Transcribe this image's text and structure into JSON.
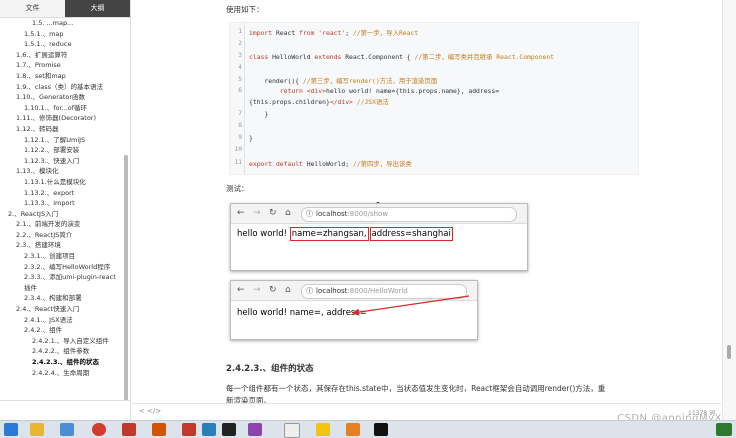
{
  "sidebar": {
    "tabs": [
      {
        "label": "文件"
      },
      {
        "label": "大纲"
      }
    ],
    "toc": [
      {
        "label": "1.5. ...map..."
      },
      {
        "label": "1.5.1.、map"
      },
      {
        "label": "1.5.1.、reduce"
      },
      {
        "label": "1.6.、扩展运算符"
      },
      {
        "label": "1.7.、Promise"
      },
      {
        "label": "1.8.、set和map"
      },
      {
        "label": "1.9.、class（类）的基本语法"
      },
      {
        "label": "1.10.、Generator函数"
      },
      {
        "label": "1.10.1.、for...of循环"
      },
      {
        "label": "1.11.、修饰器(Decorator)"
      },
      {
        "label": "1.12.、转码器"
      },
      {
        "label": "1.12.1.、了解UmiJS"
      },
      {
        "label": "1.12.2.、部署安装"
      },
      {
        "label": "1.12.3.、快速入门"
      },
      {
        "label": "1.13.、模块化"
      },
      {
        "label": "1.13.1.什么是模块化"
      },
      {
        "label": "1.13.2.、export"
      },
      {
        "label": "1.13.3.、import"
      },
      {
        "label": "2.、ReactJS入门"
      },
      {
        "label": "2.1.、前端开发的演变"
      },
      {
        "label": "2.2.、ReactJS简介"
      },
      {
        "label": "2.3.、搭建环境"
      },
      {
        "label": "2.3.1.、创建项目"
      },
      {
        "label": "2.3.2.、编写HelloWorld程序"
      },
      {
        "label": "2.3.3.、添加umi-plugin-react"
      },
      {
        "label": "插件"
      },
      {
        "label": "2.3.4.、构建和部署"
      },
      {
        "label": "2.4.、React快速入门"
      },
      {
        "label": "2.4.1.、JSX语法"
      },
      {
        "label": "2.4.2.、组件"
      },
      {
        "label": "2.4.2.1.、导入自定义组件"
      },
      {
        "label": "2.4.2.2.、组件参数"
      },
      {
        "label": "2.4.2.3.、组件的状态"
      },
      {
        "label": "2.4.2.4.、生命周期"
      }
    ]
  },
  "main": {
    "usage_text": "使用如下：",
    "code_lines": [
      {
        "n": "1",
        "t": "import React from 'react'; //第一步，导入React"
      },
      {
        "n": "2",
        "t": ""
      },
      {
        "n": "3",
        "t": "class HelloWorld extends React.Component { //第二步，编写类并且继承 React.Component"
      },
      {
        "n": "4",
        "t": ""
      },
      {
        "n": "5",
        "t": "    render(){ //第三步，编写render()方法，用于渲染页面"
      },
      {
        "n": "6",
        "t": "        return <div>hello world! name={this.props.name}, address="
      },
      {
        "n": "",
        "t": "{this.props.children}</div> //JSX语法"
      },
      {
        "n": "7",
        "t": "    }"
      },
      {
        "n": "8",
        "t": ""
      },
      {
        "n": "9",
        "t": "}"
      },
      {
        "n": "10",
        "t": ""
      },
      {
        "n": "11",
        "t": "export default HelloWorld; //第四步，导出该类"
      }
    ],
    "test_label": "测试：",
    "browser1": {
      "url_host": "localhost",
      "url_path": ":8000/show",
      "text_prefix": "hello world! ",
      "name_part": "name=zhangsan,",
      "addr_part": "address=shanghai"
    },
    "browser2": {
      "url_host": "localhost",
      "url_path": ":8000/HelloWorld",
      "text": "hello world! name=, address="
    },
    "section_heading": "2.4.2.3.、组件的状态",
    "para_line1": "每一个组件都有一个状态，其保存在this.state中，当状态值发生变化时，React框架会自动调用render()方法，重",
    "para_line2": "新渲染页面。"
  },
  "status": {
    "left": "<   </>",
    "word_count": "11378 词"
  },
  "watermark": "CSDN @anningMyX"
}
